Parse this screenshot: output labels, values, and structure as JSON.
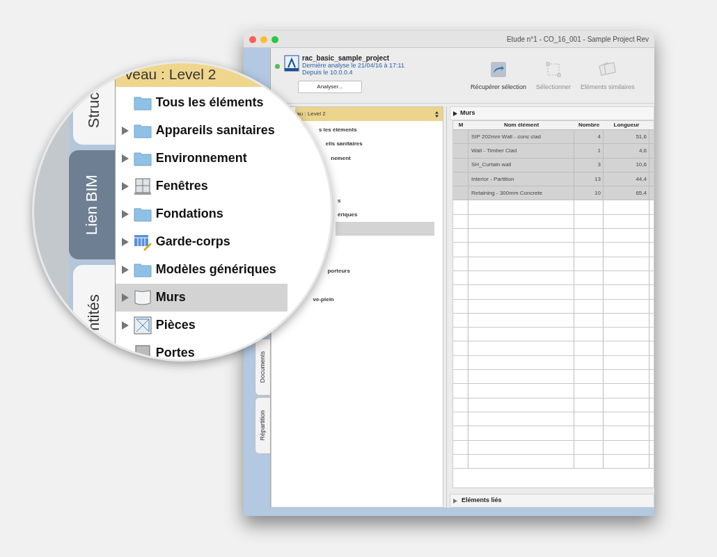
{
  "window": {
    "title": "Etude n°1 - CO_16_001 - Sample Project Rev"
  },
  "side_tabs": [
    {
      "label": "Documents",
      "selected": false
    },
    {
      "label": "Répartition",
      "selected": false
    }
  ],
  "project": {
    "name": "rac_basic_sample_project",
    "last_analysis": "Dernière analyse le 21/04/16 à 17:11",
    "since": "Depuis le 10.0.0.4",
    "analyze_button": "Analyser..."
  },
  "toolbar": [
    {
      "label": "Récupérer sélection",
      "disabled": false,
      "kind": "fetch"
    },
    {
      "label": "Sélectionner",
      "disabled": true,
      "kind": "select"
    },
    {
      "label": "Eléments similaires",
      "disabled": true,
      "kind": "similar"
    }
  ],
  "tree": {
    "level_selector": "au : Level 2",
    "rows": [
      {
        "text": "s les éléments",
        "selected": false
      },
      {
        "text": "eils sanitaires",
        "selected": false
      },
      {
        "text": "nement",
        "selected": false
      },
      {
        "selected": false
      },
      {
        "selected": false
      },
      {
        "text": "s",
        "selected": false
      },
      {
        "text": "ériques",
        "selected": false
      },
      {
        "selected": true
      },
      {
        "selected": false
      },
      {
        "selected": false
      },
      {
        "text": "porteurs",
        "selected": false
      },
      {
        "selected": false
      },
      {
        "text": "ve-plein",
        "selected": false
      }
    ]
  },
  "table": {
    "section": "Murs",
    "columns": [
      "M",
      "Nom élément",
      "Nombre",
      "Longueur"
    ],
    "rows": [
      {
        "name": "SIP 202mm Wall - conc clad",
        "count": "4",
        "length": "51,6",
        "selected": true
      },
      {
        "name": "Wall - Timber Clad",
        "count": "1",
        "length": "4,6",
        "selected": true
      },
      {
        "name": "SH_Curtain wall",
        "count": "3",
        "length": "10,6",
        "selected": true
      },
      {
        "name": "Interior - Partition",
        "count": "13",
        "length": "44,4",
        "selected": true
      },
      {
        "name": "Retaining - 300mm Concrete",
        "count": "10",
        "length": "65,4",
        "selected": true
      }
    ]
  },
  "linked_section": {
    "label": "Eléments liés",
    "expanded": false
  },
  "magnifier": {
    "tabs": [
      {
        "label": "Struc",
        "selected": false
      },
      {
        "label": "Lien BIM",
        "selected": true
      },
      {
        "label": "ntités",
        "selected": false
      }
    ],
    "level_selector": "veau : Level 2",
    "items": [
      {
        "label": "Tous les éléments",
        "kind": "folder",
        "expandable": false,
        "selected": false
      },
      {
        "label": "Appareils sanitaires",
        "kind": "folder",
        "expandable": true,
        "selected": false
      },
      {
        "label": "Environnement",
        "kind": "folder",
        "expandable": true,
        "selected": false
      },
      {
        "label": "Fenêtres",
        "kind": "window",
        "expandable": true,
        "selected": false
      },
      {
        "label": "Fondations",
        "kind": "folder",
        "expandable": true,
        "selected": false
      },
      {
        "label": "Garde-corps",
        "kind": "railing",
        "expandable": true,
        "selected": false
      },
      {
        "label": "Modèles génériques",
        "kind": "folder",
        "expandable": true,
        "selected": false
      },
      {
        "label": "Murs",
        "kind": "wall",
        "expandable": true,
        "selected": true
      },
      {
        "label": "Pièces",
        "kind": "room",
        "expandable": true,
        "selected": false
      },
      {
        "label": "Portes",
        "kind": "door",
        "selected": false
      }
    ]
  }
}
